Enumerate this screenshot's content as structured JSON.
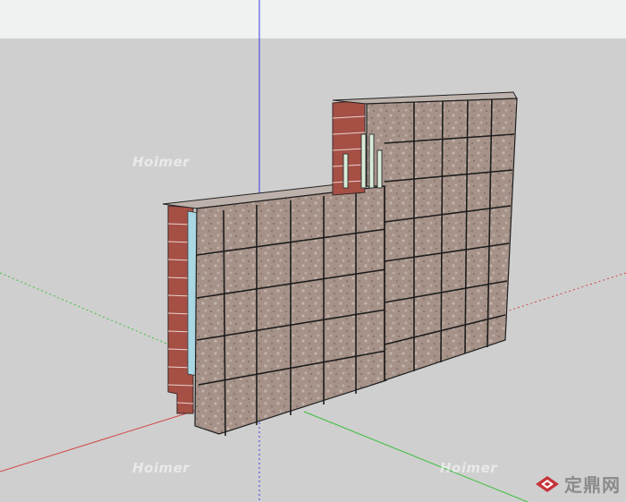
{
  "viewport": {
    "sky_color": "#f0f1f1",
    "ground_color": "#cfcfcf"
  },
  "axes": {
    "blue_axis_color": "#3a3af0",
    "red_axis_color": "#d24646",
    "green_axis_color": "#3cbf3c"
  },
  "model": {
    "stone_color": "#a9988f",
    "brick_color": "#a64f45",
    "insulation_color": "#a9d8e4"
  },
  "watermarks": {
    "left": "Hoimer",
    "bottom_left": "Hoimer",
    "bottom_right": "Hoimer"
  },
  "brand": {
    "logo_text": "定鼎网",
    "logo_icon": "diamond-logo-icon"
  }
}
